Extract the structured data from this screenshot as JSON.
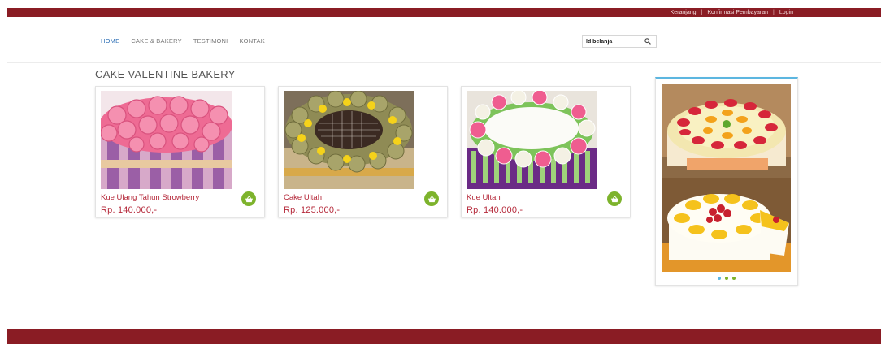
{
  "topbar": {
    "links": [
      "Keranjang",
      "Konfirmasi Pembayaran",
      "Login"
    ],
    "separator": "|"
  },
  "nav": {
    "items": [
      "HOME",
      "CAKE & BAKERY",
      "TESTIMONI",
      "KONTAK"
    ]
  },
  "search": {
    "value": "ld belanja"
  },
  "section_title": "CAKE VALENTINE BAKERY",
  "products": [
    {
      "name": "Kue Ulang Tahun Strowberry",
      "price": "Rp. 140.000,-"
    },
    {
      "name": "Cake Ultah",
      "price": "Rp. 125.000,-"
    },
    {
      "name": "Kue Ultah",
      "price": "Rp. 140.000,-"
    }
  ],
  "colors": {
    "brand": "#8a1c24",
    "accent": "#7db32c",
    "price": "#b5293a",
    "link_active": "#2d6fb6"
  },
  "icons": {
    "search": "search-icon",
    "cart": "basket-icon"
  }
}
